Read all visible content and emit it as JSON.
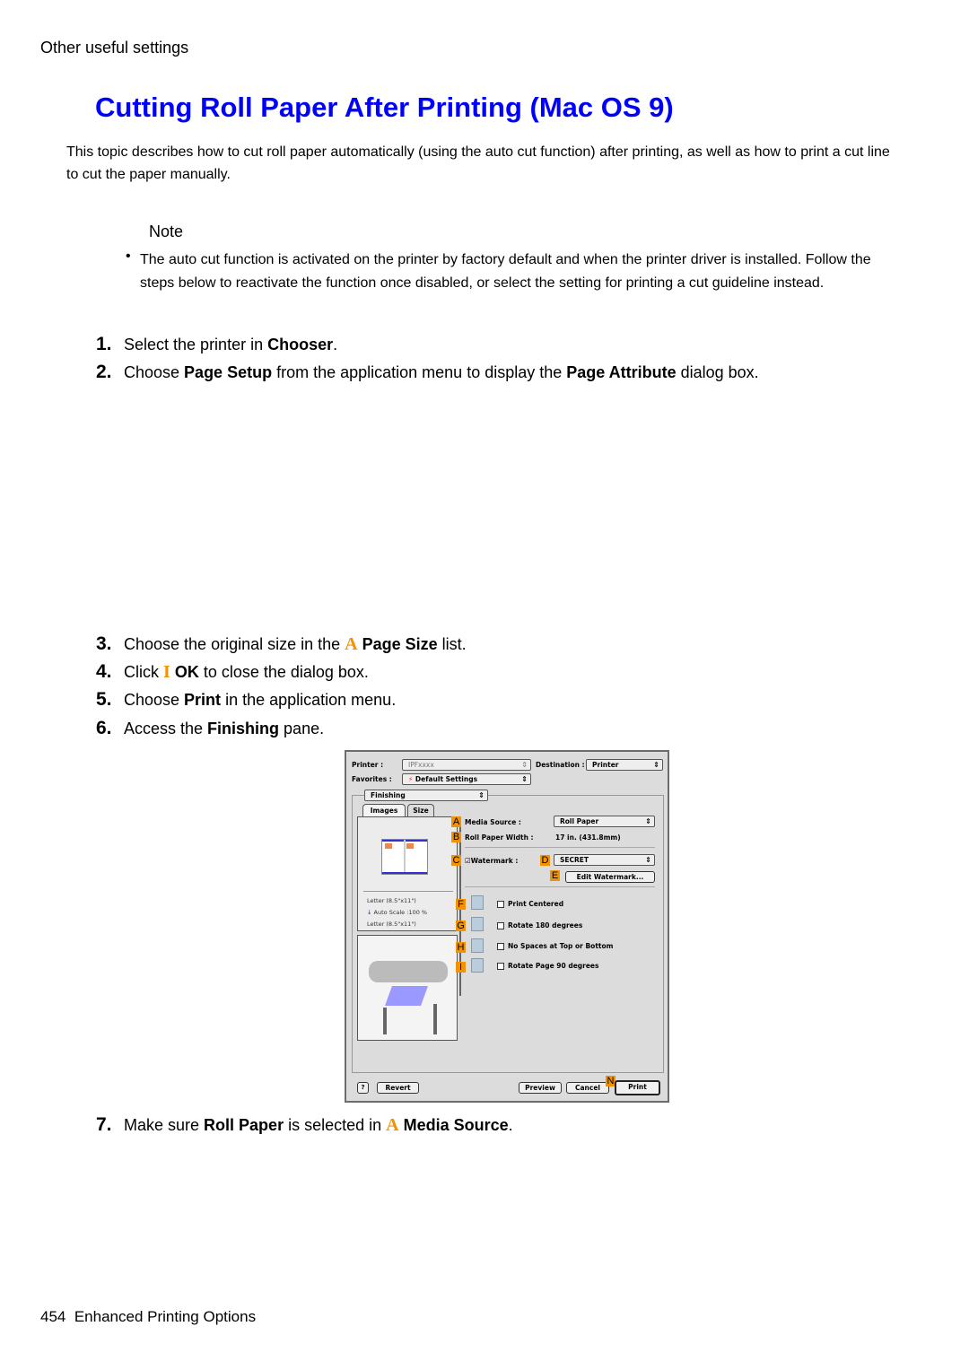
{
  "header": {
    "section": "Other useful settings"
  },
  "title": "Cutting Roll Paper After Printing (Mac OS 9)",
  "intro": "This topic describes how to cut roll paper automatically (using the auto cut function) after printing, as well as how to print a cut line to cut the paper manually.",
  "note": {
    "label": "Note",
    "bullet": "•",
    "text": "The auto cut function is activated on the printer by factory default and when the printer driver is installed. Follow the steps below to reactivate the function once disabled, or select the setting for printing a cut guideline instead."
  },
  "steps": [
    {
      "num": "1.",
      "pre": "Select the printer in ",
      "b1": "Chooser",
      "post": "."
    },
    {
      "num": "2.",
      "pre": "Choose ",
      "b1": "Page Setup",
      "mid": " from the application menu to display the ",
      "b2": "Page Attribute",
      "post": " dialog box."
    },
    {
      "num": "3.",
      "pre": "Choose the original size in the ",
      "marker": "A",
      "b1": "Page Size",
      "post": " list."
    },
    {
      "num": "4.",
      "pre": "Click ",
      "marker": "I",
      "b1": "OK",
      "post": " to close the dialog box."
    },
    {
      "num": "5.",
      "pre": "Choose ",
      "b1": "Print",
      "post": " in the application menu."
    },
    {
      "num": "6.",
      "pre": "Access the ",
      "b1": "Finishing",
      "post": " pane."
    },
    {
      "num": "7.",
      "pre": "Make sure ",
      "b1": "Roll Paper",
      "mid": " is selected in ",
      "marker": "A",
      "b2": "Media Source",
      "post": "."
    }
  ],
  "dialog": {
    "printer_label": "Printer :",
    "printer_value": "IPFxxxx",
    "destination_label": "Destination :",
    "destination_value": "Printer",
    "favorites_label": "Favorites :",
    "favorites_value": "Default Settings",
    "pane_value": "Finishing",
    "tabs": [
      "Images",
      "Size"
    ],
    "media_source_label": "Media Source :",
    "media_source_value": "Roll Paper",
    "roll_width_label": "Roll Paper Width :",
    "roll_width_value": "17 in. (431.8mm)",
    "watermark_label": "Watermark :",
    "watermark_value": "SECRET",
    "watermark_checked": "☑",
    "edit_watermark": "Edit Watermark...",
    "preview_info": [
      "Letter (8.5\"x11\")",
      "Auto Scale :100 %",
      "Letter (8.5\"x11\")"
    ],
    "options": [
      "Print Centered",
      "Rotate 180 degrees",
      "No Spaces at Top or Bottom",
      "Rotate Page 90 degrees"
    ],
    "buttons": {
      "help": "?",
      "revert": "Revert",
      "preview": "Preview",
      "cancel": "Cancel",
      "print": "Print"
    },
    "badges": [
      "A",
      "B",
      "C",
      "D",
      "E",
      "F",
      "G",
      "H",
      "I",
      "N"
    ]
  },
  "footer": {
    "page": "454",
    "text": "Enhanced Printing Options"
  }
}
